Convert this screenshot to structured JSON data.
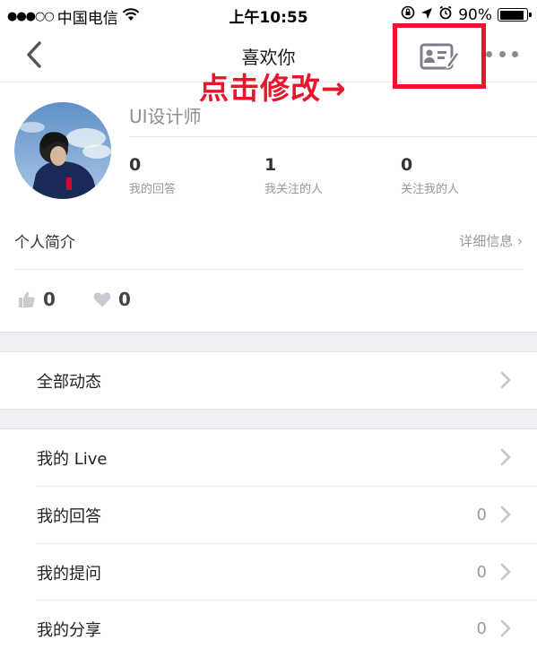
{
  "status_bar": {
    "signal_dots": "●●●○○",
    "carrier": "中国电信",
    "time": "上午10:55",
    "battery": "90%",
    "battery_level": 0.9,
    "icons": [
      "wifi-icon",
      "rotation-lock-icon",
      "location-arrow-icon",
      "alarm-icon",
      "battery-icon"
    ]
  },
  "nav": {
    "title": "喜欢你",
    "back_icon": "chevron-left-icon",
    "edit_icon": "profile-card-edit-icon",
    "more_icon": "more-dots-icon"
  },
  "annotation": {
    "text": "点击修改→",
    "color": "#e8152b"
  },
  "profile": {
    "username": "UI设计师",
    "stats": [
      {
        "value": "0",
        "label": "我的回答"
      },
      {
        "value": "1",
        "label": "我关注的人"
      },
      {
        "value": "0",
        "label": "关注我的人"
      }
    ],
    "bio_label": "个人简介",
    "bio_detail": "详细信息 ›",
    "likes": {
      "thumbs_up": "0",
      "hearts": "0"
    }
  },
  "menu": {
    "all_activity": "全部动态",
    "items": [
      {
        "label": "我的 Live",
        "count": ""
      },
      {
        "label": "我的回答",
        "count": "0"
      },
      {
        "label": "我的提问",
        "count": "0"
      },
      {
        "label": "我的分享",
        "count": "0"
      }
    ]
  },
  "colors": {
    "accent_red": "#e8152b",
    "icon_gray": "#8a8a93",
    "separator_bg": "#efeff4"
  }
}
